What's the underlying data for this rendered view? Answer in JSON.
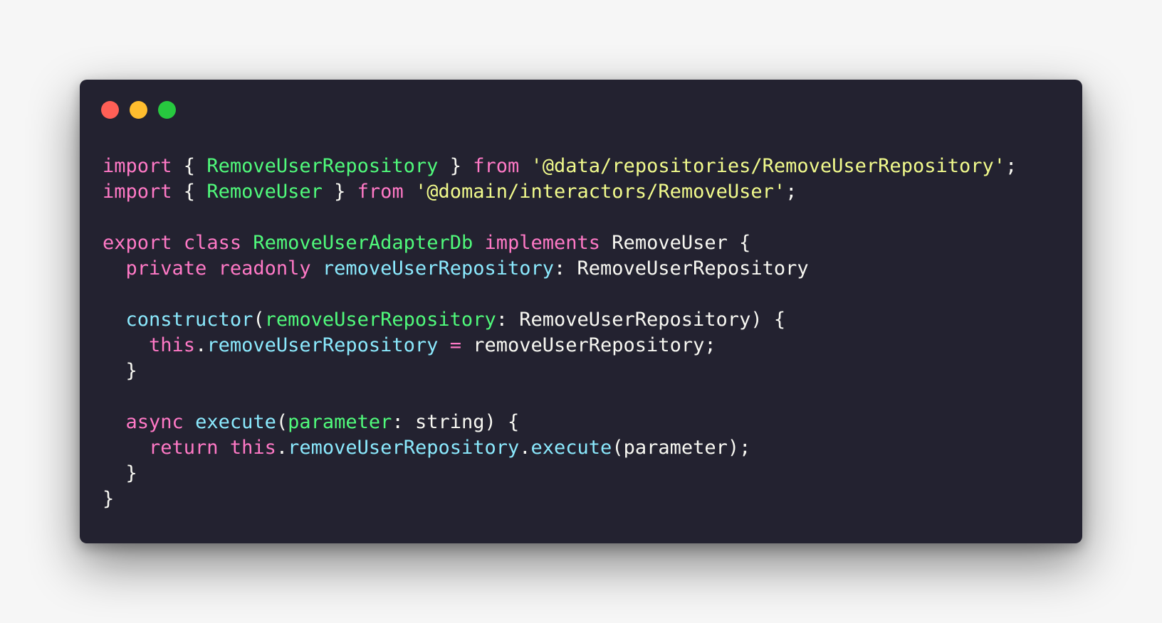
{
  "window": {
    "buttons": [
      {
        "name": "close-button",
        "color": "#ff5f56"
      },
      {
        "name": "minimize-button",
        "color": "#ffbd2e"
      },
      {
        "name": "zoom-button",
        "color": "#27c93f"
      }
    ]
  },
  "code": {
    "lines": [
      [
        {
          "t": "import",
          "k": "kw"
        },
        {
          "t": " { ",
          "k": "txt"
        },
        {
          "t": "RemoveUserRepository",
          "k": "fn"
        },
        {
          "t": " } ",
          "k": "txt"
        },
        {
          "t": "from",
          "k": "kw"
        },
        {
          "t": " ",
          "k": "txt"
        },
        {
          "t": "'@data/repositories/RemoveUserRepository'",
          "k": "str"
        },
        {
          "t": ";",
          "k": "txt"
        }
      ],
      [
        {
          "t": "import",
          "k": "kw"
        },
        {
          "t": " { ",
          "k": "txt"
        },
        {
          "t": "RemoveUser",
          "k": "fn"
        },
        {
          "t": " } ",
          "k": "txt"
        },
        {
          "t": "from",
          "k": "kw"
        },
        {
          "t": " ",
          "k": "txt"
        },
        {
          "t": "'@domain/interactors/RemoveUser'",
          "k": "str"
        },
        {
          "t": ";",
          "k": "txt"
        }
      ],
      [],
      [
        {
          "t": "export",
          "k": "kw"
        },
        {
          "t": " ",
          "k": "txt"
        },
        {
          "t": "class",
          "k": "kw"
        },
        {
          "t": " ",
          "k": "txt"
        },
        {
          "t": "RemoveUserAdapterDb",
          "k": "fn"
        },
        {
          "t": " ",
          "k": "txt"
        },
        {
          "t": "implements",
          "k": "kw"
        },
        {
          "t": " RemoveUser {",
          "k": "txt"
        }
      ],
      [
        {
          "t": "  ",
          "k": "txt"
        },
        {
          "t": "private",
          "k": "kw"
        },
        {
          "t": " ",
          "k": "txt"
        },
        {
          "t": "readonly",
          "k": "kw"
        },
        {
          "t": " ",
          "k": "txt"
        },
        {
          "t": "removeUserRepository",
          "k": "prop"
        },
        {
          "t": ": RemoveUserRepository",
          "k": "txt"
        }
      ],
      [],
      [
        {
          "t": "  ",
          "k": "txt"
        },
        {
          "t": "constructor",
          "k": "prop"
        },
        {
          "t": "(",
          "k": "txt"
        },
        {
          "t": "removeUserRepository",
          "k": "fn"
        },
        {
          "t": ": RemoveUserRepository) {",
          "k": "txt"
        }
      ],
      [
        {
          "t": "    ",
          "k": "txt"
        },
        {
          "t": "this",
          "k": "kw"
        },
        {
          "t": ".",
          "k": "txt"
        },
        {
          "t": "removeUserRepository",
          "k": "prop"
        },
        {
          "t": " ",
          "k": "txt"
        },
        {
          "t": "=",
          "k": "kw"
        },
        {
          "t": " removeUserRepository;",
          "k": "txt"
        }
      ],
      [
        {
          "t": "  }",
          "k": "txt"
        }
      ],
      [],
      [
        {
          "t": "  ",
          "k": "txt"
        },
        {
          "t": "async",
          "k": "kw"
        },
        {
          "t": " ",
          "k": "txt"
        },
        {
          "t": "execute",
          "k": "prop"
        },
        {
          "t": "(",
          "k": "txt"
        },
        {
          "t": "parameter",
          "k": "fn"
        },
        {
          "t": ": string) {",
          "k": "txt"
        }
      ],
      [
        {
          "t": "    ",
          "k": "txt"
        },
        {
          "t": "return",
          "k": "kw"
        },
        {
          "t": " ",
          "k": "txt"
        },
        {
          "t": "this",
          "k": "kw"
        },
        {
          "t": ".",
          "k": "txt"
        },
        {
          "t": "removeUserRepository",
          "k": "prop"
        },
        {
          "t": ".",
          "k": "txt"
        },
        {
          "t": "execute",
          "k": "prop"
        },
        {
          "t": "(parameter);",
          "k": "txt"
        }
      ],
      [
        {
          "t": "  }",
          "k": "txt"
        }
      ],
      [
        {
          "t": "}",
          "k": "txt"
        }
      ]
    ]
  }
}
